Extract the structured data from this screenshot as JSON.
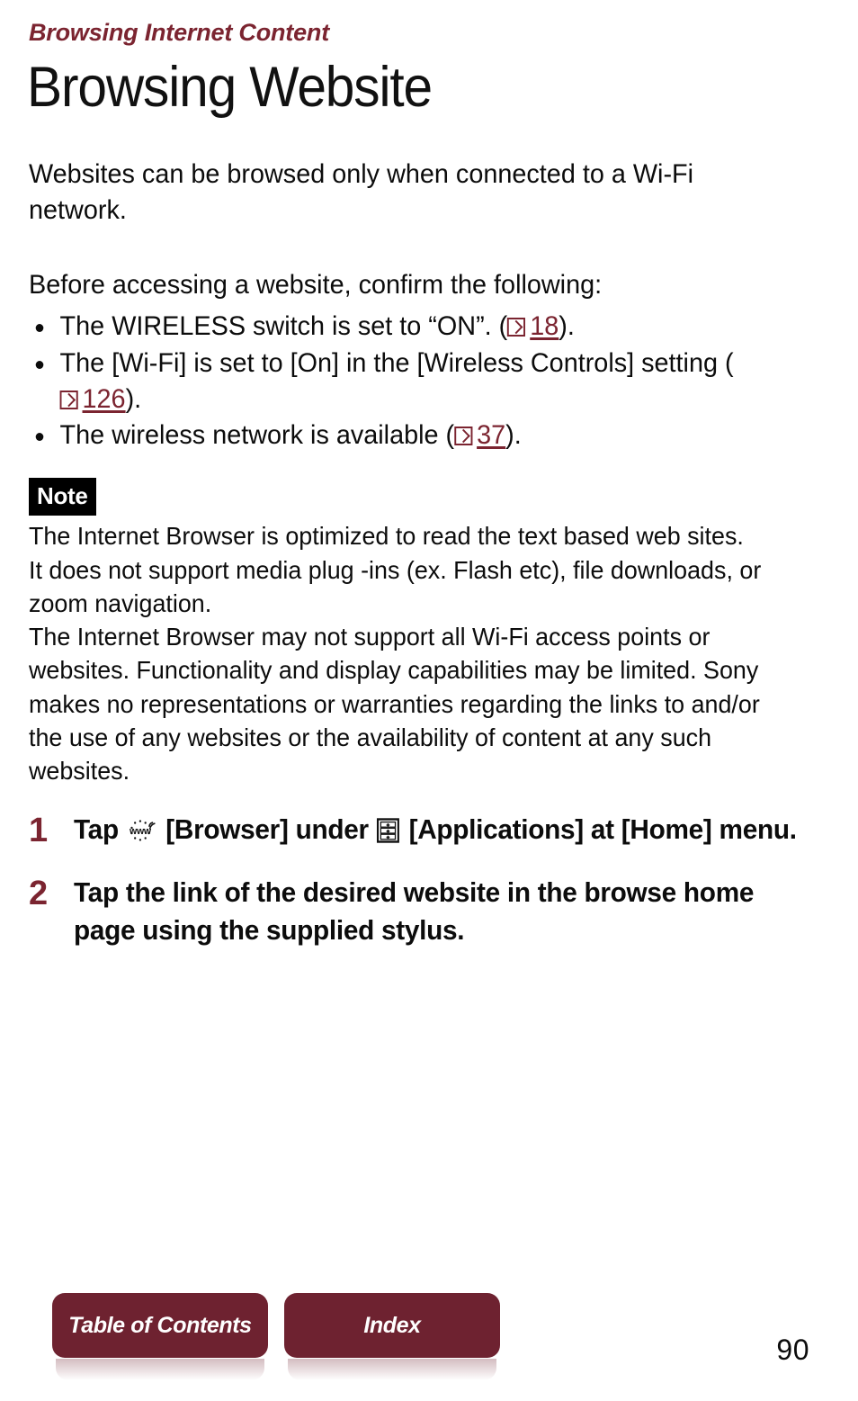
{
  "header": {
    "chapter": "Browsing Internet Content",
    "title": "Browsing Website"
  },
  "intro": {
    "paragraph_1": "Websites can be browsed only when connected to a Wi-Fi network.",
    "paragraph_2": "Before accessing a website, confirm the following:"
  },
  "bullets": [
    {
      "text_before": "The WIRELESS switch is set to “ON”. (",
      "ref_icon": "page-reference-icon",
      "ref_page": "18",
      "text_after": ")."
    },
    {
      "text_before": "The [Wi-Fi] is set to [On] in the [Wireless Controls] setting (",
      "ref_icon": "page-reference-icon",
      "ref_page": "126",
      "text_after": ")."
    },
    {
      "text_before": "The wireless network is available (",
      "ref_icon": "page-reference-icon",
      "ref_page": "37",
      "text_after": ")."
    }
  ],
  "note": {
    "badge": "Note",
    "line_1": "The Internet Browser is optimized to read the text based web sites.",
    "line_2": "It does not support media plug -ins (ex. Flash etc), file downloads, or zoom navigation.",
    "line_3": "The Internet Browser may not support all Wi-Fi access points or websites. Functionality and display capabilities may be limited. Sony makes no representations or warranties regarding the links to and/or the use of any websites or the availability of content at any such websites."
  },
  "steps": [
    {
      "number": "1",
      "part_1": "Tap ",
      "icon_1": "www-browser-icon",
      "part_2": " [Browser] under ",
      "icon_2": "applications-list-icon",
      "part_3": " [Applications] at [Home] menu."
    },
    {
      "number": "2",
      "part_1": "Tap the link of the desired website in the browse home page using the supplied stylus.",
      "icon_1": "",
      "part_2": "",
      "icon_2": "",
      "part_3": ""
    }
  ],
  "footer": {
    "toc_label": "Table of Contents",
    "index_label": "Index",
    "page_number": "90"
  },
  "colors": {
    "accent": "#7b2430",
    "button": "#6e2230",
    "text": "#0c0c0c",
    "note_badge_bg": "#000000"
  }
}
